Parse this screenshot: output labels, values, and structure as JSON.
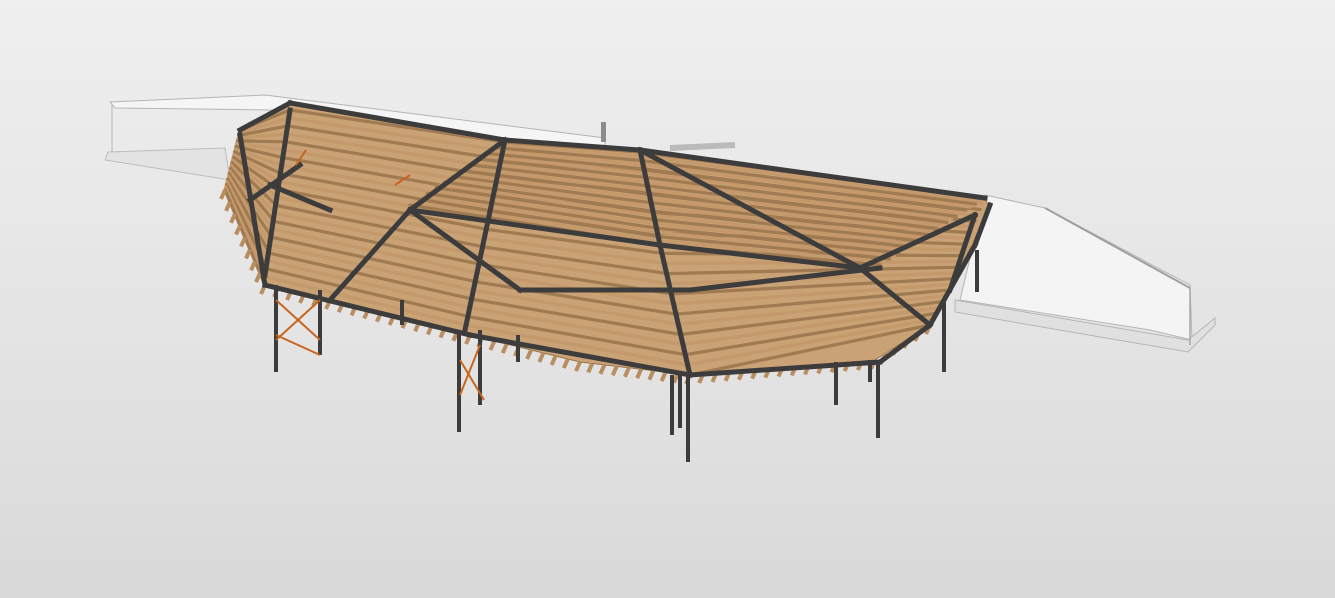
{
  "viewport": {
    "background_top": "#efefef",
    "background_bottom": "#d9d9d9"
  },
  "model": {
    "colors": {
      "timber": "#c4996b",
      "timber_dark": "#a07a50",
      "steel": "#3c3c3c",
      "bracing": "#c8651f",
      "wall": "#f2f2f2",
      "wall_edge": "#b9b9b9"
    }
  }
}
